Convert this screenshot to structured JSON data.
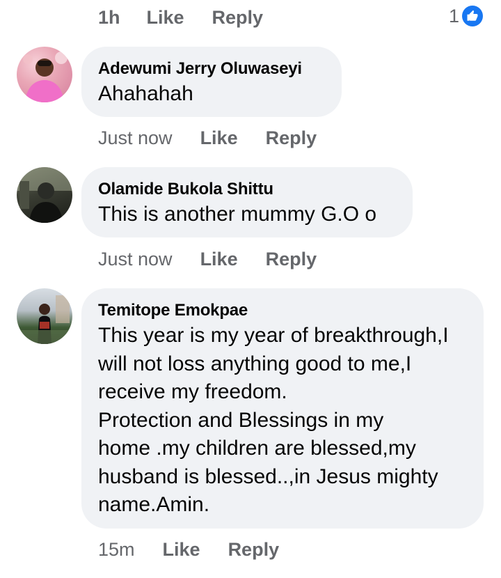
{
  "top_meta": {
    "time": "1h",
    "like_label": "Like",
    "reply_label": "Reply",
    "reaction_count": "1"
  },
  "comments": [
    {
      "author": "Adewumi Jerry Oluwaseyi",
      "text": "Ahahahah",
      "time": "Just now",
      "like_label": "Like",
      "reply_label": "Reply"
    },
    {
      "author": "Olamide Bukola Shittu",
      "text": "This is another mummy G.O o",
      "time": "Just now",
      "like_label": "Like",
      "reply_label": "Reply"
    },
    {
      "author": "Temitope Emokpae",
      "text": "This year is my year of breakthrough,I\nwill not loss anything good to me,I\nreceive my freedom.\nProtection and Blessings in my\nhome .my children are blessed,my\nhusband is blessed..,in Jesus mighty\nname.Amin.",
      "time": "15m",
      "like_label": "Like",
      "reply_label": "Reply"
    }
  ],
  "colors": {
    "bubble_bg": "#f0f2f5",
    "meta_text": "#65676b",
    "like_blue": "#1877f2",
    "name_text": "#050505"
  },
  "icons": {
    "reaction": "thumbs-up-icon"
  }
}
